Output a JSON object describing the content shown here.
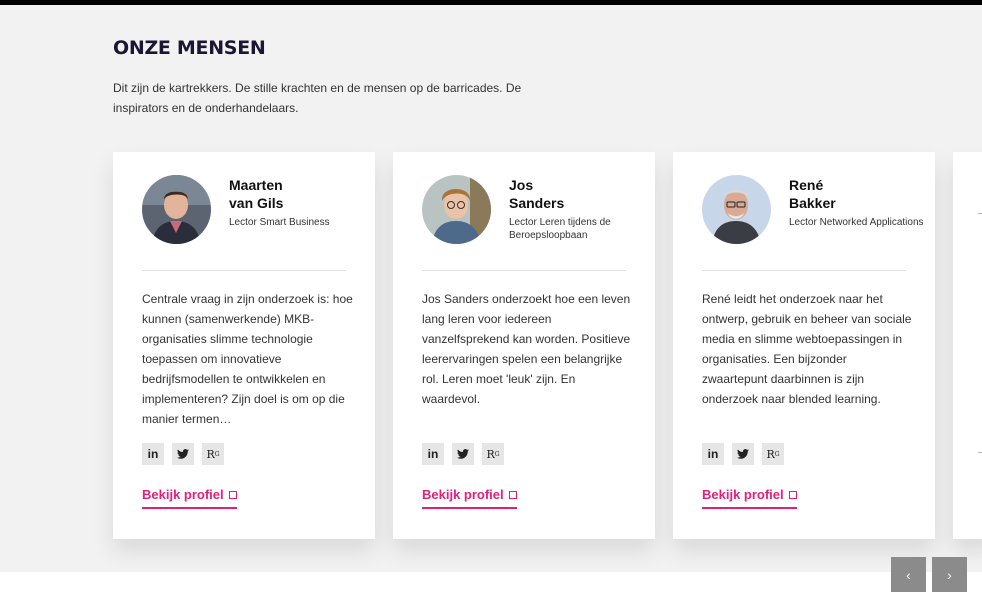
{
  "section": {
    "title": "ONZE MENSEN",
    "intro": "Dit zijn de kartrekkers. De stille krachten en de mensen op de barricades. De inspirators en de onderhandelaars."
  },
  "people": [
    {
      "first_name": "Maarten",
      "last_name": "van Gils",
      "role": "Lector Smart Business",
      "description": "Centrale vraag in zijn onderzoek is: hoe kunnen (samenwerkende) MKB-organisaties slimme technologie toepassen om innovatieve bedrijfsmodellen te ontwikkelen en implementeren? Zijn doel is om op die manier termen…",
      "social": [
        "linkedin-icon",
        "twitter-icon",
        "researchgate-icon"
      ],
      "profile_link": "Bekijk profiel"
    },
    {
      "first_name": "Jos",
      "last_name": "Sanders",
      "role": "Lector Leren tijdens de Beroepsloopbaan",
      "description": "Jos Sanders onderzoekt hoe een leven lang leren voor iedereen vanzelfsprekend kan worden. Positieve leerervaringen spelen een belangrijke rol. Leren moet 'leuk' zijn. En waardevol.",
      "social": [
        "linkedin-icon",
        "twitter-icon",
        "researchgate-icon"
      ],
      "profile_link": "Bekijk profiel"
    },
    {
      "first_name": "René",
      "last_name": "Bakker",
      "role": "Lector Networked Applications",
      "description": "René leidt het onderzoek naar het ontwerp, gebruik en beheer van sociale media en slimme webtoepassingen in organisaties. Een bijzonder zwaartepunt daarbinnen is zijn onderzoek naar blended learning.",
      "social": [
        "linkedin-icon",
        "twitter-icon",
        "researchgate-icon"
      ],
      "profile_link": "Bekijk profiel"
    }
  ],
  "social_labels": {
    "linkedin": "in",
    "twitter": "🐦",
    "researchgate": "R",
    "researchgate_sup": "G"
  },
  "nav": {
    "prev": "‹",
    "next": "›"
  },
  "colors": {
    "accent": "#e0207a",
    "title": "#1d1633",
    "nav_button": "#8b8b8b"
  }
}
